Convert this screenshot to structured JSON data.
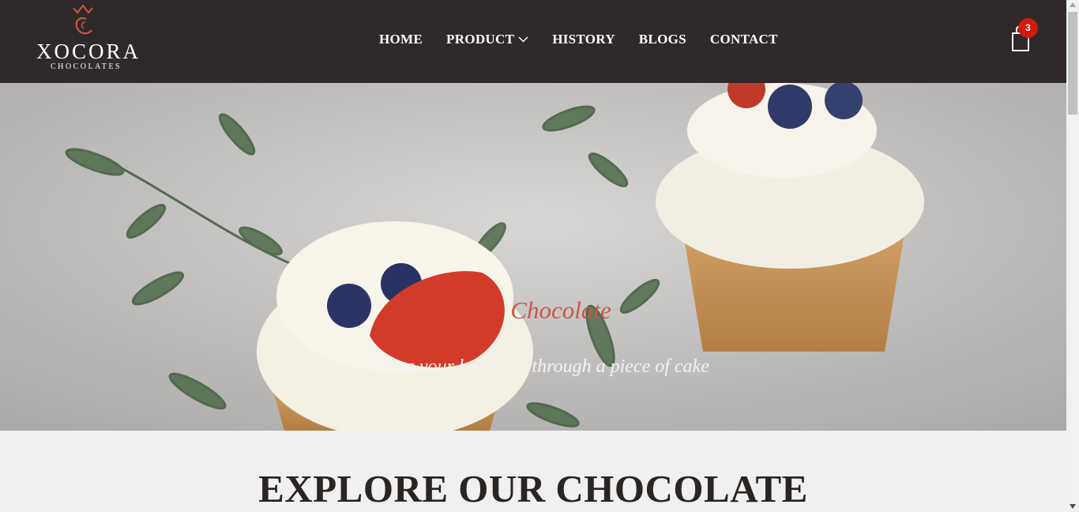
{
  "brand": {
    "name": "XOCORA",
    "tagline": "CHOCOLATES",
    "accent_color": "#c95745",
    "header_color": "#2f2a29"
  },
  "nav": {
    "items": [
      {
        "label": "HOME"
      },
      {
        "label": "PRODUCT",
        "has_dropdown": true
      },
      {
        "label": "HISTORY"
      },
      {
        "label": "BLOGS"
      },
      {
        "label": "CONTACT"
      }
    ]
  },
  "cart": {
    "icon": "shopping-bag-icon",
    "count": "3",
    "badge_color": "#d11a0c"
  },
  "hero": {
    "title": "Chocolate",
    "subtitle": "Bring your happines through a piece of cake",
    "image": "cupcakes-with-berries-photo"
  },
  "section": {
    "title": "EXPLORE OUR CHOCOLATE"
  }
}
